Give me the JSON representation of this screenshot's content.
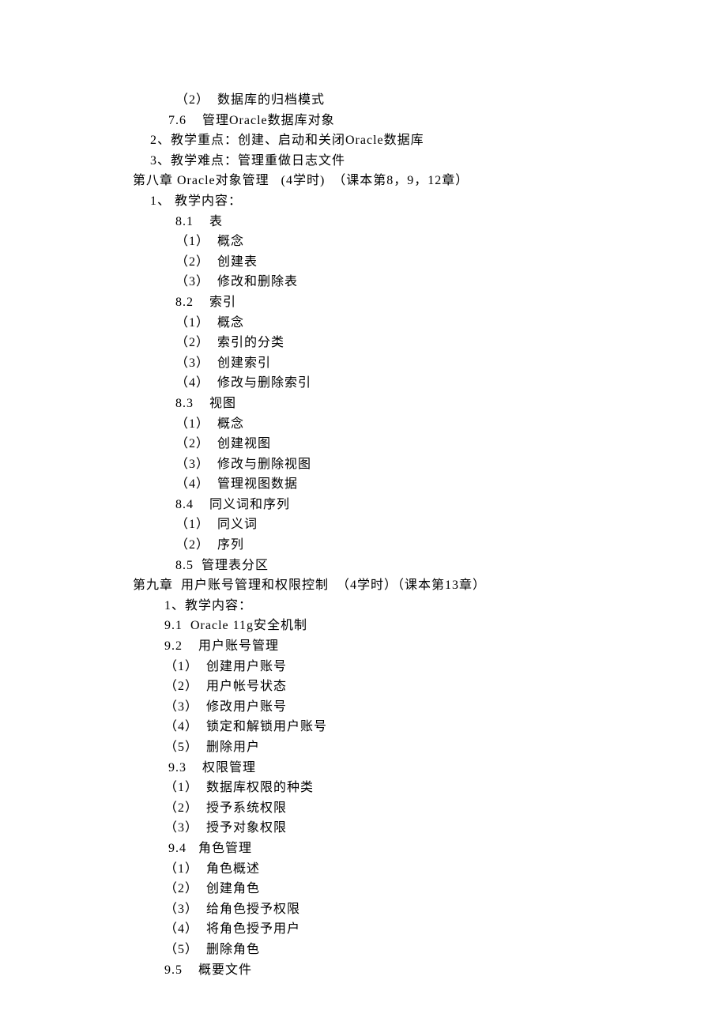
{
  "lines": [
    {
      "indent": "i3",
      "text": "（2）  数据库的归档模式"
    },
    {
      "indent": "i2",
      "text": " 7.6    管理Oracle数据库对象"
    },
    {
      "indent": "i1",
      "text": "2、教学重点：创建、启动和关闭Oracle数据库"
    },
    {
      "indent": "i1",
      "text": "3、教学难点：管理重做日志文件"
    },
    {
      "indent": "i0",
      "text": "第八章 Oracle对象管理   (4学时)  （课本第8，9，12章）"
    },
    {
      "indent": "i1",
      "text": "1、 教学内容："
    },
    {
      "indent": "i3",
      "text": "8.1    表"
    },
    {
      "indent": "i3",
      "text": "（1）  概念"
    },
    {
      "indent": "i3",
      "text": "（2）  创建表"
    },
    {
      "indent": "i3",
      "text": "（3）  修改和删除表"
    },
    {
      "indent": "i3",
      "text": "8.2    索引"
    },
    {
      "indent": "i3",
      "text": "（1）  概念"
    },
    {
      "indent": "i3",
      "text": "（2）  索引的分类"
    },
    {
      "indent": "i3",
      "text": "（3）  创建索引"
    },
    {
      "indent": "i3",
      "text": "（4）  修改与删除索引"
    },
    {
      "indent": "i3",
      "text": "8.3    视图"
    },
    {
      "indent": "i3",
      "text": "（1）  概念"
    },
    {
      "indent": "i3",
      "text": "（2）  创建视图"
    },
    {
      "indent": "i3",
      "text": "（3）  修改与删除视图"
    },
    {
      "indent": "i3",
      "text": "（4）  管理视图数据"
    },
    {
      "indent": "i3",
      "text": "8.4    同义词和序列"
    },
    {
      "indent": "i3",
      "text": "（1）  同义词"
    },
    {
      "indent": "i3",
      "text": "（2）  序列"
    },
    {
      "indent": "i3",
      "text": "8.5  管理表分区"
    },
    {
      "indent": "i0",
      "text": "第九章  用户账号管理和权限控制  （4学时）（课本第13章）"
    },
    {
      "indent": "i2",
      "text": "1、教学内容："
    },
    {
      "indent": "i2",
      "text": "9.1  Oracle 11g安全机制"
    },
    {
      "indent": "i2",
      "text": "9.2    用户账号管理"
    },
    {
      "indent": "i2",
      "text": "（1）  创建用户账号"
    },
    {
      "indent": "i2",
      "text": "（2）  用户帐号状态"
    },
    {
      "indent": "i2",
      "text": "（3）  修改用户账号"
    },
    {
      "indent": "i2",
      "text": "（4）  锁定和解锁用户账号"
    },
    {
      "indent": "i2",
      "text": "（5）  删除用户"
    },
    {
      "indent": "i2",
      "text": " 9.3    权限管理"
    },
    {
      "indent": "i2",
      "text": "（1）  数据库权限的种类"
    },
    {
      "indent": "i2",
      "text": "（2）  授予系统权限"
    },
    {
      "indent": "i2",
      "text": "（3）  授予对象权限"
    },
    {
      "indent": "i2",
      "text": " 9.4   角色管理"
    },
    {
      "indent": "i2",
      "text": "（1）  角色概述"
    },
    {
      "indent": "i2",
      "text": "（2）  创建角色"
    },
    {
      "indent": "i2",
      "text": "（3）  给角色授予权限"
    },
    {
      "indent": "i2",
      "text": "（4）  将角色授予用户"
    },
    {
      "indent": "i2",
      "text": "（5）  删除角色"
    },
    {
      "indent": "i2",
      "text": "9.5    概要文件"
    }
  ]
}
